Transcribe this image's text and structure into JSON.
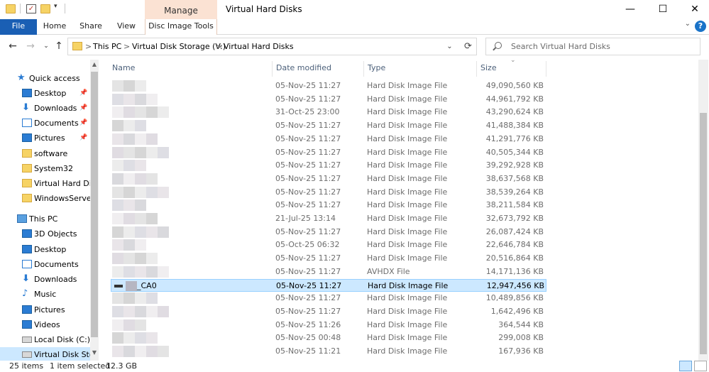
{
  "window": {
    "title": "Virtual Hard Disks",
    "manage_tab": "Manage",
    "minimize": "—",
    "maximize": "☐",
    "close": "✕"
  },
  "ribbon": {
    "tabs": [
      "File",
      "Home",
      "Share",
      "View",
      "Disc Image Tools"
    ],
    "help": "?"
  },
  "address": {
    "crumbs": [
      "This PC",
      "Virtual Disk Storage (V:)",
      "Virtual Hard Disks"
    ],
    "separator": ">"
  },
  "search": {
    "placeholder": "Search Virtual Hard Disks"
  },
  "sidebar": {
    "quick_access": "Quick access",
    "quick_items": [
      "Desktop",
      "Downloads",
      "Documents",
      "Pictures",
      "software",
      "System32",
      "Virtual Hard Disk",
      "WindowsServerE"
    ],
    "this_pc": "This PC",
    "pc_items": [
      "3D Objects",
      "Desktop",
      "Documents",
      "Downloads",
      "Music",
      "Pictures",
      "Videos",
      "Local Disk (C:)",
      "Virtual Disk Stora"
    ]
  },
  "columns": {
    "name": "Name",
    "date": "Date modified",
    "type": "Type",
    "size": "Size"
  },
  "files": [
    {
      "name": "",
      "date": "05-Nov-25 11:27",
      "type": "Hard Disk Image File",
      "size": "49,090,560 KB"
    },
    {
      "name": "",
      "date": "05-Nov-25 11:27",
      "type": "Hard Disk Image File",
      "size": "44,961,792 KB"
    },
    {
      "name": "",
      "date": "31-Oct-25 23:00",
      "type": "Hard Disk Image File",
      "size": "43,290,624 KB"
    },
    {
      "name": "",
      "date": "05-Nov-25 11:27",
      "type": "Hard Disk Image File",
      "size": "41,488,384 KB"
    },
    {
      "name": "",
      "date": "05-Nov-25 11:27",
      "type": "Hard Disk Image File",
      "size": "41,291,776 KB"
    },
    {
      "name": "",
      "date": "05-Nov-25 11:27",
      "type": "Hard Disk Image File",
      "size": "40,505,344 KB"
    },
    {
      "name": "",
      "date": "05-Nov-25 11:27",
      "type": "Hard Disk Image File",
      "size": "39,292,928 KB"
    },
    {
      "name": "",
      "date": "05-Nov-25 11:27",
      "type": "Hard Disk Image File",
      "size": "38,637,568 KB"
    },
    {
      "name": "",
      "date": "05-Nov-25 11:27",
      "type": "Hard Disk Image File",
      "size": "38,539,264 KB"
    },
    {
      "name": "",
      "date": "05-Nov-25 11:27",
      "type": "Hard Disk Image File",
      "size": "38,211,584 KB"
    },
    {
      "name": "",
      "date": "21-Jul-25 13:14",
      "type": "Hard Disk Image File",
      "size": "32,673,792 KB"
    },
    {
      "name": "",
      "date": "05-Nov-25 11:27",
      "type": "Hard Disk Image File",
      "size": "26,087,424 KB"
    },
    {
      "name": "",
      "date": "05-Oct-25 06:32",
      "type": "Hard Disk Image File",
      "size": "22,646,784 KB"
    },
    {
      "name": "",
      "date": "05-Nov-25 11:27",
      "type": "Hard Disk Image File",
      "size": "20,516,864 KB"
    },
    {
      "name": "",
      "date": "05-Nov-25 11:27",
      "type": "AVHDX File",
      "size": "14,171,136 KB"
    },
    {
      "name": "_CA0",
      "date": "05-Nov-25 11:27",
      "type": "Hard Disk Image File",
      "size": "12,947,456 KB"
    },
    {
      "name": "",
      "date": "05-Nov-25 11:27",
      "type": "Hard Disk Image File",
      "size": "10,489,856 KB"
    },
    {
      "name": "",
      "date": "05-Nov-25 11:27",
      "type": "Hard Disk Image File",
      "size": "1,642,496 KB"
    },
    {
      "name": "",
      "date": "05-Nov-25 11:26",
      "type": "Hard Disk Image File",
      "size": "364,544 KB"
    },
    {
      "name": "",
      "date": "05-Nov-25 00:48",
      "type": "Hard Disk Image File",
      "size": "299,008 KB"
    },
    {
      "name": "",
      "date": "05-Nov-25 11:21",
      "type": "Hard Disk Image File",
      "size": "167,936 KB"
    }
  ],
  "selected_index": 15,
  "status": {
    "items": "25 items",
    "selected": "1 item selected",
    "size": "12.3 GB"
  },
  "colors": {
    "accent": "#1a5fb4",
    "selection": "#cce8ff",
    "manage": "#fbe2d3"
  }
}
